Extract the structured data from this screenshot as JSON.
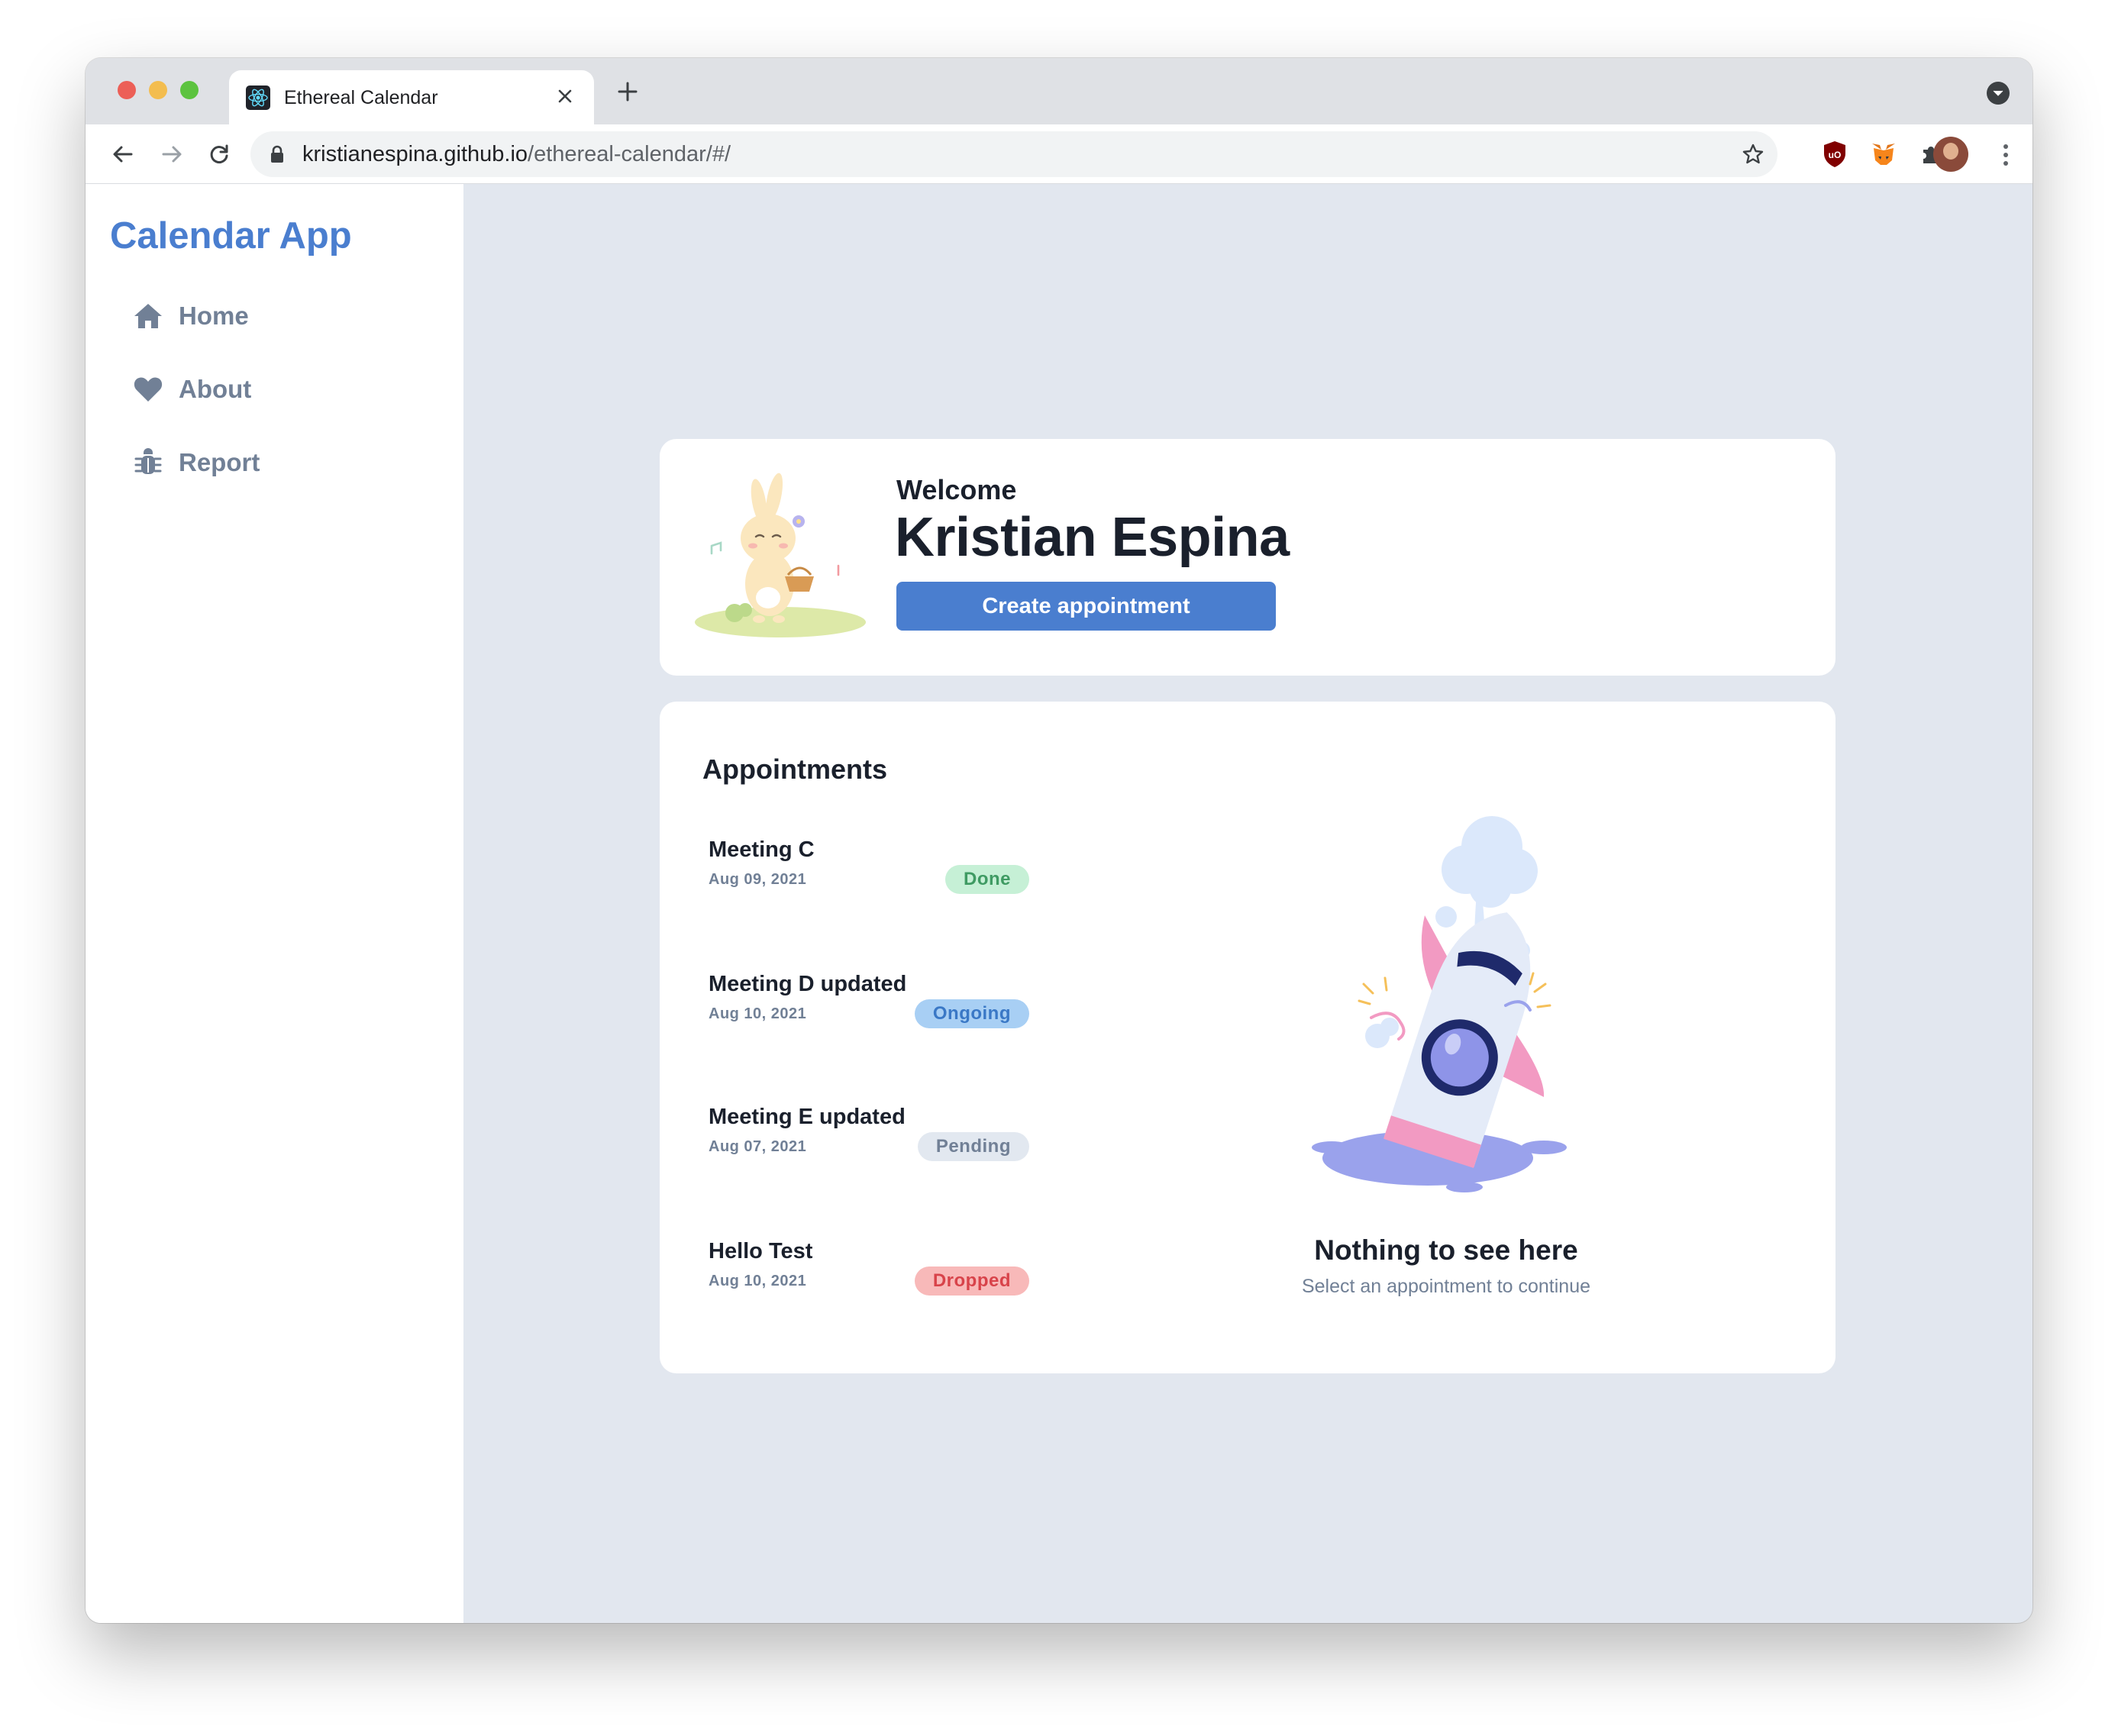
{
  "browser": {
    "tab_title": "Ethereal Calendar",
    "url_host": "kristianespina.github.io",
    "url_path": "/ethereal-calendar/#/"
  },
  "sidebar": {
    "brand": "Calendar App",
    "items": [
      {
        "label": "Home",
        "icon": "home-icon"
      },
      {
        "label": "About",
        "icon": "heart-icon"
      },
      {
        "label": "Report",
        "icon": "bug-icon"
      }
    ]
  },
  "welcome": {
    "label": "Welcome",
    "name": "Kristian Espina",
    "button_label": "Create appointment"
  },
  "appointments": {
    "title": "Appointments",
    "items": [
      {
        "title": "Meeting C",
        "date": "Aug 09, 2021",
        "status": "Done"
      },
      {
        "title": "Meeting D updated",
        "date": "Aug 10, 2021",
        "status": "Ongoing"
      },
      {
        "title": "Meeting E updated",
        "date": "Aug 07, 2021",
        "status": "Pending"
      },
      {
        "title": "Hello Test",
        "date": "Aug 10, 2021",
        "status": "Dropped"
      }
    ],
    "empty_title": "Nothing to see here",
    "empty_subtitle": "Select an appointment to continue"
  },
  "colors": {
    "accent": "#4a7ecf",
    "sidebar_text": "#718096",
    "page_bg": "#e2e7ef",
    "done_bg": "#c6f0d6",
    "done_fg": "#3f9b63",
    "ongoing_bg": "#a8cff4",
    "ongoing_fg": "#3a78c6",
    "pending_bg": "#e2e8f0",
    "pending_fg": "#718096",
    "dropped_bg": "#f8b9b9",
    "dropped_fg": "#d8434a"
  }
}
